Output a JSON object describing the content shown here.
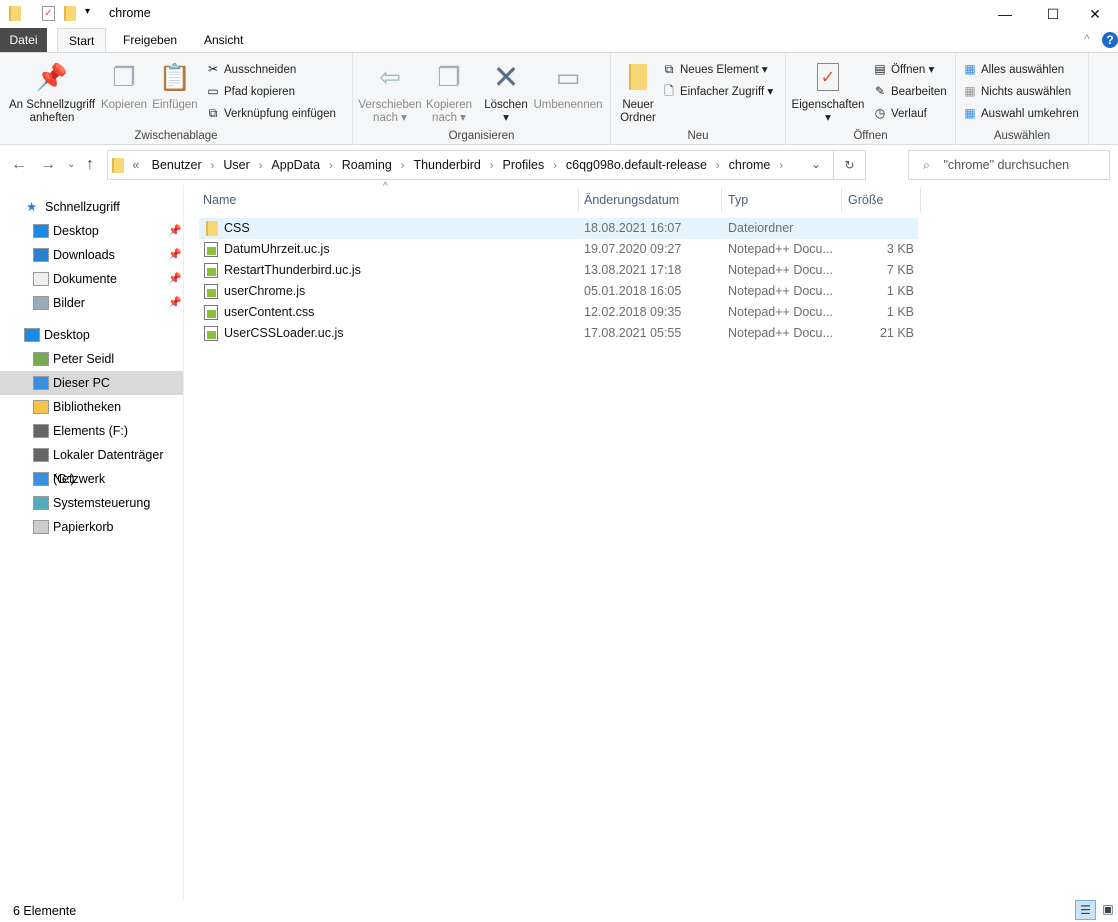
{
  "window": {
    "title": "chrome",
    "minimize": "—",
    "maximize": "☐",
    "close": "✕"
  },
  "tabs": [
    {
      "label": "Datei"
    },
    {
      "label": "Start"
    },
    {
      "label": "Freigeben"
    },
    {
      "label": "Ansicht"
    }
  ],
  "ribbon": {
    "clipboard": {
      "group": "Zwischenablage",
      "pin1": "An Schnellzugriff",
      "pin2": "anheften",
      "copy": "Kopieren",
      "paste": "Einfügen",
      "cut": "Ausschneiden",
      "copy_path": "Pfad kopieren",
      "paste_shortcut": "Verknüpfung einfügen"
    },
    "organize": {
      "group": "Organisieren",
      "move1": "Verschieben",
      "move2": "nach",
      "copyto1": "Kopieren",
      "copyto2": "nach",
      "delete": "Löschen",
      "rename": "Umbenennen"
    },
    "new": {
      "group": "Neu",
      "folder1": "Neuer",
      "folder2": "Ordner",
      "new_item": "Neues Element",
      "easy_access": "Einfacher Zugriff"
    },
    "open": {
      "group": "Öffnen",
      "properties": "Eigenschaften",
      "open": "Öffnen",
      "edit": "Bearbeiten",
      "history": "Verlauf"
    },
    "select": {
      "group": "Auswählen",
      "all": "Alles auswählen",
      "none": "Nichts auswählen",
      "invert": "Auswahl umkehren"
    }
  },
  "address": {
    "prefix": "«",
    "crumbs": [
      "Benutzer",
      "User",
      "AppData",
      "Roaming",
      "Thunderbird",
      "Profiles",
      "c6qg098o.default-release",
      "chrome"
    ]
  },
  "search": {
    "placeholder": "\"chrome\" durchsuchen"
  },
  "nav": {
    "quick": "Schnellzugriff",
    "quick_items": [
      "Desktop",
      "Downloads",
      "Dokumente",
      "Bilder"
    ],
    "items": [
      "Desktop",
      "Peter Seidl",
      "Dieser PC",
      "Bibliotheken",
      "Elements (F:)",
      "Lokaler Datenträger (G:)",
      "Netzwerk",
      "Systemsteuerung",
      "Papierkorb"
    ]
  },
  "columns": {
    "name": "Name",
    "date": "Änderungsdatum",
    "type": "Typ",
    "size": "Größe"
  },
  "files": [
    {
      "name": "CSS",
      "date": "18.08.2021 16:07",
      "type": "Dateiordner",
      "size": ""
    },
    {
      "name": "DatumUhrzeit.uc.js",
      "date": "19.07.2020 09:27",
      "type": "Notepad++ Docu...",
      "size": "3 KB"
    },
    {
      "name": "RestartThunderbird.uc.js",
      "date": "13.08.2021 17:18",
      "type": "Notepad++ Docu...",
      "size": "7 KB"
    },
    {
      "name": "userChrome.js",
      "date": "05.01.2018 16:05",
      "type": "Notepad++ Docu...",
      "size": "1 KB"
    },
    {
      "name": "userContent.css",
      "date": "12.02.2018 09:35",
      "type": "Notepad++ Docu...",
      "size": "1 KB"
    },
    {
      "name": "UserCSSLoader.uc.js",
      "date": "17.08.2021 05:55",
      "type": "Notepad++ Docu...",
      "size": "21 KB"
    }
  ],
  "status": "6 Elemente"
}
